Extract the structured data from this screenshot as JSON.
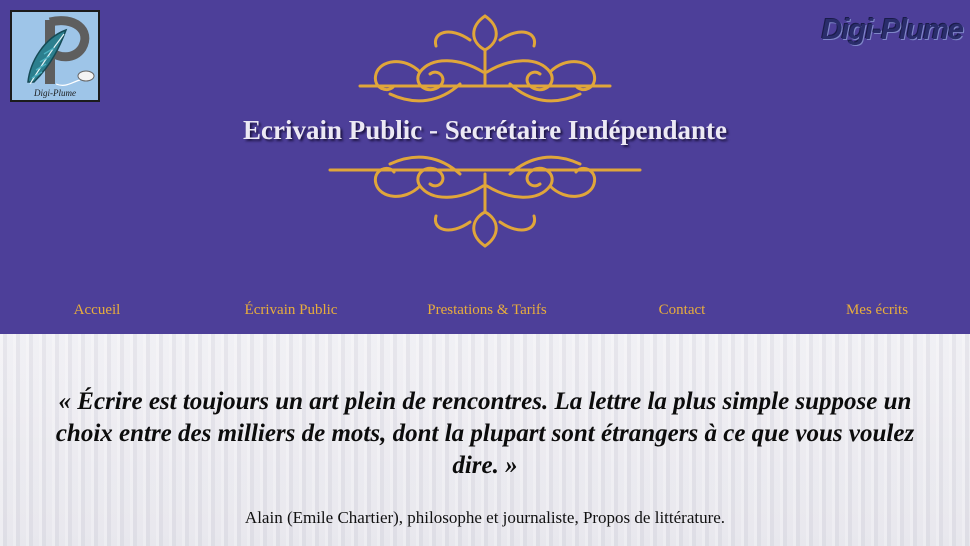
{
  "logo": {
    "caption": "Digi-Plume",
    "icon": "quill-mouse-logo-icon"
  },
  "brand": {
    "text": "Digi-Plume"
  },
  "header": {
    "title": "Ecrivain Public - Secrétaire Indépendante"
  },
  "nav": {
    "items": [
      {
        "label": "Accueil"
      },
      {
        "label": "Écrivain Public"
      },
      {
        "label": "Prestations & Tarifs"
      },
      {
        "label": "Contact"
      },
      {
        "label": "Mes écrits"
      }
    ]
  },
  "main": {
    "quote": "« Écrire est toujours un art plein de rencontres. La lettre la plus simple suppose un choix entre des milliers de mots, dont la plupart sont étrangers à ce que vous voulez dire. »",
    "attribution": "Alain (Emile Chartier), philosophe et journaliste, Propos de littérature."
  },
  "colors": {
    "header_bg": "#4d3f99",
    "accent_gold": "#e0a63a",
    "nav_text": "#e8ad3c",
    "title_text": "#ece9f4"
  }
}
